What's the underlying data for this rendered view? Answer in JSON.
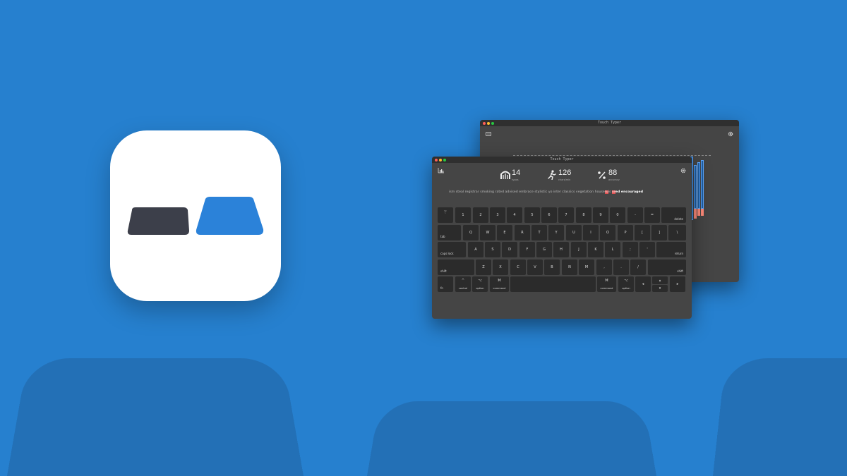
{
  "back_window": {
    "title": "Touch Typer"
  },
  "front_window": {
    "title": "Touch Typer"
  },
  "stats": [
    {
      "value": "14",
      "label": "typos",
      "icon": "typos-icon"
    },
    {
      "value": "126",
      "label": "chars/min",
      "icon": "running-person-icon"
    },
    {
      "value": "88",
      "label": "accuracy",
      "icon": "percent-icon"
    }
  ],
  "typing": {
    "done": "ism steal registrar smoking rated advised embrace stylistic yo inter classics vegetation hou",
    "current_left": "se",
    "current_err": "ru",
    "current_right": "i",
    "current_tail": "s ",
    "typo": "or",
    "next": "ed encouraged"
  },
  "keyboard": {
    "row1": [
      {
        "top": "~",
        "main": "`"
      },
      {
        "main": "1"
      },
      {
        "main": "2"
      },
      {
        "main": "3"
      },
      {
        "main": "4"
      },
      {
        "main": "5"
      },
      {
        "main": "6"
      },
      {
        "main": "7"
      },
      {
        "main": "8"
      },
      {
        "main": "9"
      },
      {
        "main": "0"
      },
      {
        "main": "-"
      },
      {
        "main": "="
      },
      {
        "br": "delete"
      }
    ],
    "row2": [
      {
        "bl": "tab"
      },
      {
        "main": "Q"
      },
      {
        "main": "W"
      },
      {
        "main": "E"
      },
      {
        "main": "R"
      },
      {
        "main": "T"
      },
      {
        "main": "Y"
      },
      {
        "main": "U"
      },
      {
        "main": "I"
      },
      {
        "main": "O"
      },
      {
        "main": "P"
      },
      {
        "main": "["
      },
      {
        "main": "]"
      },
      {
        "main": "\\"
      }
    ],
    "row3": [
      {
        "bl": "caps lock"
      },
      {
        "main": "A"
      },
      {
        "main": "S"
      },
      {
        "main": "D"
      },
      {
        "main": "F"
      },
      {
        "main": "G"
      },
      {
        "main": "H"
      },
      {
        "main": "J"
      },
      {
        "main": "K"
      },
      {
        "main": "L"
      },
      {
        "main": ";"
      },
      {
        "main": "'"
      },
      {
        "br": "return"
      }
    ],
    "row4": [
      {
        "bl": "shift"
      },
      {
        "main": "Z"
      },
      {
        "main": "X"
      },
      {
        "main": "C"
      },
      {
        "main": "V"
      },
      {
        "main": "B"
      },
      {
        "main": "N"
      },
      {
        "main": "M"
      },
      {
        "main": ","
      },
      {
        "main": "."
      },
      {
        "main": "/"
      },
      {
        "br": "shift"
      }
    ],
    "row5": [
      {
        "bl": "fn"
      },
      {
        "top": "^",
        "bc": "control"
      },
      {
        "top": "⌥",
        "bc": "option"
      },
      {
        "top": "⌘",
        "bc": "command"
      },
      {
        "main": ""
      },
      {
        "top": "⌘",
        "bc": "command"
      },
      {
        "top": "⌥",
        "bc": "option"
      },
      {
        "main": "◂"
      },
      {
        "main": "▴"
      },
      {
        "main": "▾"
      },
      {
        "main": "▸"
      }
    ]
  },
  "colors": {
    "background": "#2680cf",
    "icon_dark": "#3c3f4a",
    "icon_blue": "#2b82d9",
    "error": "#e05353"
  }
}
